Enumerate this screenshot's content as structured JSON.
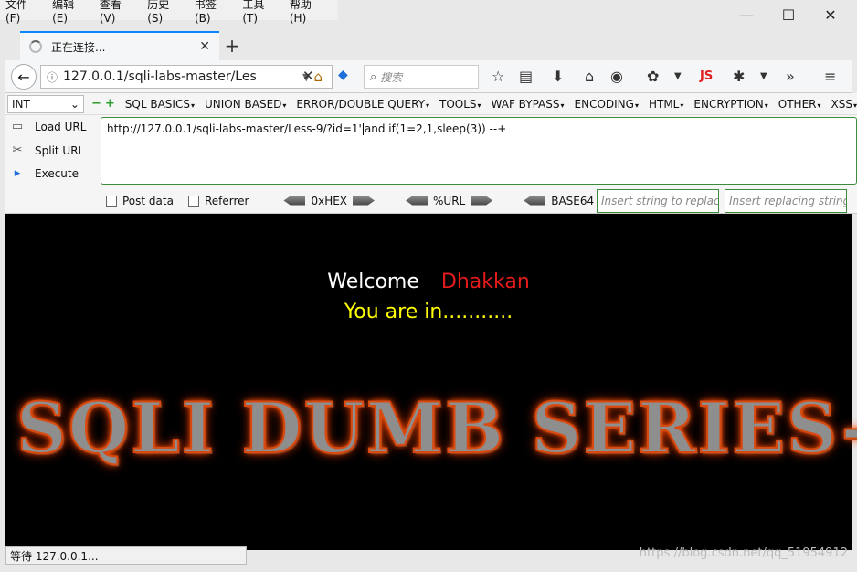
{
  "menubar": [
    "文件(F)",
    "编辑(E)",
    "查看(V)",
    "历史(S)",
    "书签(B)",
    "工具(T)",
    "帮助(H)"
  ],
  "tab": {
    "title": "正在连接..."
  },
  "address": {
    "url": "127.0.0.1/sqli-labs-master/Les"
  },
  "search": {
    "placeholder": "搜索"
  },
  "hackbar": {
    "type_select": "INT",
    "menus": [
      "SQL BASICS",
      "UNION BASED",
      "ERROR/DOUBLE QUERY",
      "TOOLS",
      "WAF BYPASS",
      "ENCODING",
      "HTML",
      "ENCRYPTION",
      "OTHER",
      "XSS"
    ],
    "load_url": "Load URL",
    "split_url": "Split URL",
    "execute": "Execute",
    "url_before_caret": "http://127.0.0.1/sqli-labs-master/Less-9/?id=1'",
    "url_after_caret": "and if(1=2,1,sleep(3)) --+",
    "post_data": "Post data",
    "referrer": "Referrer",
    "hex": "0xHEX",
    "urlenc": "%URL",
    "base64": "BASE64",
    "insert_replace_ph": "Insert string to replace",
    "insert_replacing_ph": "Insert replacing string"
  },
  "page": {
    "welcome": "Welcome",
    "name": "Dhakkan",
    "you_are_in": "You are in...........",
    "banner": "SQLI DUMB SERIES-"
  },
  "status": "等待 127.0.0.1...",
  "watermark": "https://blog.csdn.net/qq_51954912",
  "colors": {
    "welcome": "#ffffff",
    "name": "#e41b1b",
    "you_in": "#ffff00",
    "accent": "#0a84ff"
  }
}
